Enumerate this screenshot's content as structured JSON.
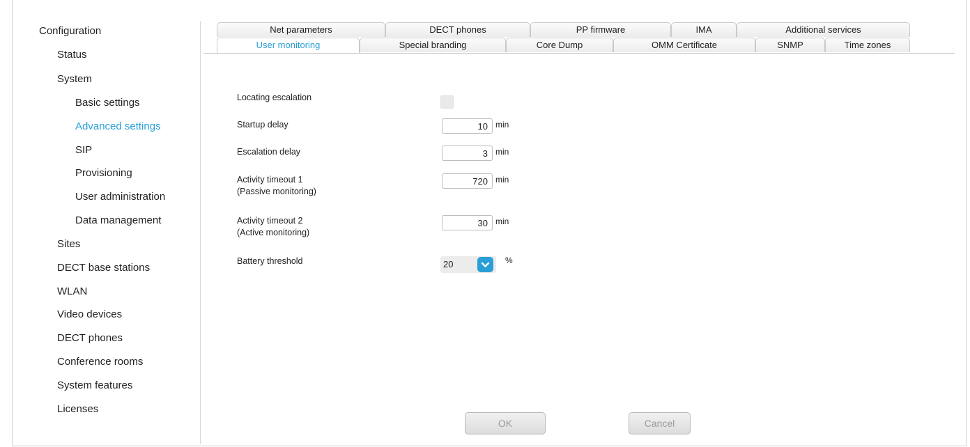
{
  "sidebar": {
    "title": "Configuration",
    "items": [
      {
        "label": "Status"
      },
      {
        "label": "System"
      },
      {
        "label": "Basic settings"
      },
      {
        "label": "Advanced settings"
      },
      {
        "label": "SIP"
      },
      {
        "label": "Provisioning"
      },
      {
        "label": "User administration"
      },
      {
        "label": "Data management"
      },
      {
        "label": "Sites"
      },
      {
        "label": "DECT base stations"
      },
      {
        "label": "WLAN"
      },
      {
        "label": "Video devices"
      },
      {
        "label": "DECT phones"
      },
      {
        "label": "Conference rooms"
      },
      {
        "label": "System features"
      },
      {
        "label": "Licenses"
      }
    ],
    "active_item": "Advanced settings"
  },
  "tabs": {
    "row1": [
      "Net parameters",
      "DECT phones",
      "PP firmware",
      "IMA",
      "Additional services"
    ],
    "row2": [
      "User monitoring",
      "Special branding",
      "Core Dump",
      "OMM Certificate",
      "SNMP",
      "Time zones"
    ],
    "active": "User monitoring"
  },
  "form": {
    "locating_escalation": {
      "label": "Locating escalation",
      "checked": false
    },
    "startup_delay": {
      "label": "Startup delay",
      "value": "10",
      "unit": "min"
    },
    "escalation_delay": {
      "label": "Escalation delay",
      "value": "3",
      "unit": "min"
    },
    "activity_timeout_1": {
      "label": "Activity timeout 1",
      "sublabel": "(Passive monitoring)",
      "value": "720",
      "unit": "min"
    },
    "activity_timeout_2": {
      "label": "Activity timeout 2",
      "sublabel": "(Active monitoring)",
      "value": "30",
      "unit": "min"
    },
    "battery_threshold": {
      "label": "Battery threshold",
      "value": "20",
      "unit": "%"
    }
  },
  "buttons": {
    "ok": "OK",
    "cancel": "Cancel"
  },
  "colors": {
    "accent": "#2a9fd6",
    "border": "#c9c9c9"
  }
}
